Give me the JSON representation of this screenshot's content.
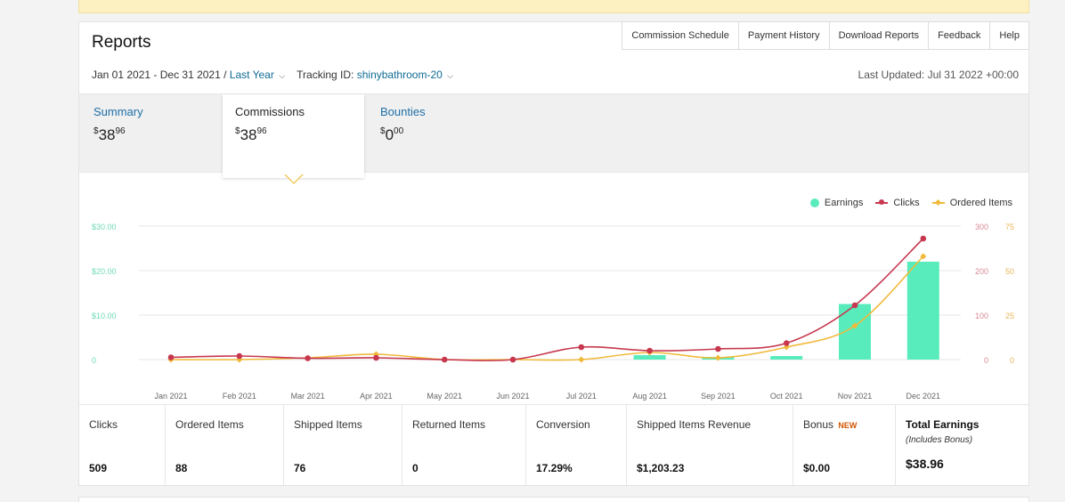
{
  "header": {
    "title": "Reports",
    "links": [
      "Commission Schedule",
      "Payment History",
      "Download Reports",
      "Feedback",
      "Help"
    ]
  },
  "filters": {
    "date_range": "Jan 01 2021 - Dec 31 2021 /",
    "period": "Last Year",
    "tracking_label": "Tracking ID:",
    "tracking_id": "shinybathroom-20",
    "last_updated": "Last Updated: Jul 31 2022 +00:00"
  },
  "tabs": [
    {
      "label": "Summary",
      "currency": "$",
      "whole": "38",
      "cents": "96"
    },
    {
      "label": "Commissions",
      "currency": "$",
      "whole": "38",
      "cents": "96"
    },
    {
      "label": "Bounties",
      "currency": "$",
      "whole": "0",
      "cents": "00"
    }
  ],
  "chart_data": {
    "type": "bar",
    "categories": [
      "Jan 2021",
      "Feb 2021",
      "Mar 2021",
      "Apr 2021",
      "May 2021",
      "Jun 2021",
      "Jul 2021",
      "Aug 2021",
      "Sep 2021",
      "Oct 2021",
      "Nov 2021",
      "Dec 2021"
    ],
    "series": [
      {
        "name": "Earnings",
        "axis": "left",
        "type": "bar",
        "color": "#58ecbd",
        "values": [
          0,
          0,
          0,
          0,
          0,
          0,
          0,
          1.0,
          0.3,
          0.8,
          12.5,
          22.0
        ]
      },
      {
        "name": "Clicks",
        "axis": "right1",
        "type": "line",
        "color": "#c7384f",
        "values": [
          5,
          8,
          3,
          4,
          0,
          0,
          28,
          20,
          24,
          37,
          122,
          272
        ]
      },
      {
        "name": "Ordered Items",
        "axis": "right2",
        "type": "line",
        "color": "#f0b93a",
        "values": [
          0,
          0,
          1,
          3,
          0,
          0,
          0,
          4,
          1,
          7,
          19,
          58
        ]
      }
    ],
    "y_left": {
      "ticks": [
        "$30.00",
        "$20.00",
        "$10.00",
        "0"
      ],
      "range": [
        0,
        30
      ]
    },
    "y_right1": {
      "ticks": [
        "300",
        "200",
        "100",
        "0"
      ],
      "range": [
        0,
        300
      ]
    },
    "y_right2": {
      "ticks": [
        "75",
        "50",
        "25",
        "0"
      ],
      "range": [
        0,
        75
      ]
    },
    "legend": [
      "Earnings",
      "Clicks",
      "Ordered Items"
    ],
    "legend_position": "top-right",
    "grid": true
  },
  "stats": [
    {
      "label": "Clicks",
      "value": "509"
    },
    {
      "label": "Ordered Items",
      "value": "88"
    },
    {
      "label": "Shipped Items",
      "value": "76"
    },
    {
      "label": "Returned Items",
      "value": "0"
    },
    {
      "label": "Conversion",
      "value": "17.29%"
    },
    {
      "label": "Shipped Items Revenue",
      "value": "$1,203.23"
    },
    {
      "label": "Bonus",
      "badge": "NEW",
      "value": "$0.00"
    },
    {
      "label": "Total Earnings",
      "sub": "(Includes Bonus)",
      "value": "$38.96"
    }
  ],
  "colors": {
    "link": "#0f6b94",
    "earnings": "#58ecbd",
    "clicks": "#c7384f",
    "ordered": "#f0b93a",
    "badge": "#d45500"
  }
}
